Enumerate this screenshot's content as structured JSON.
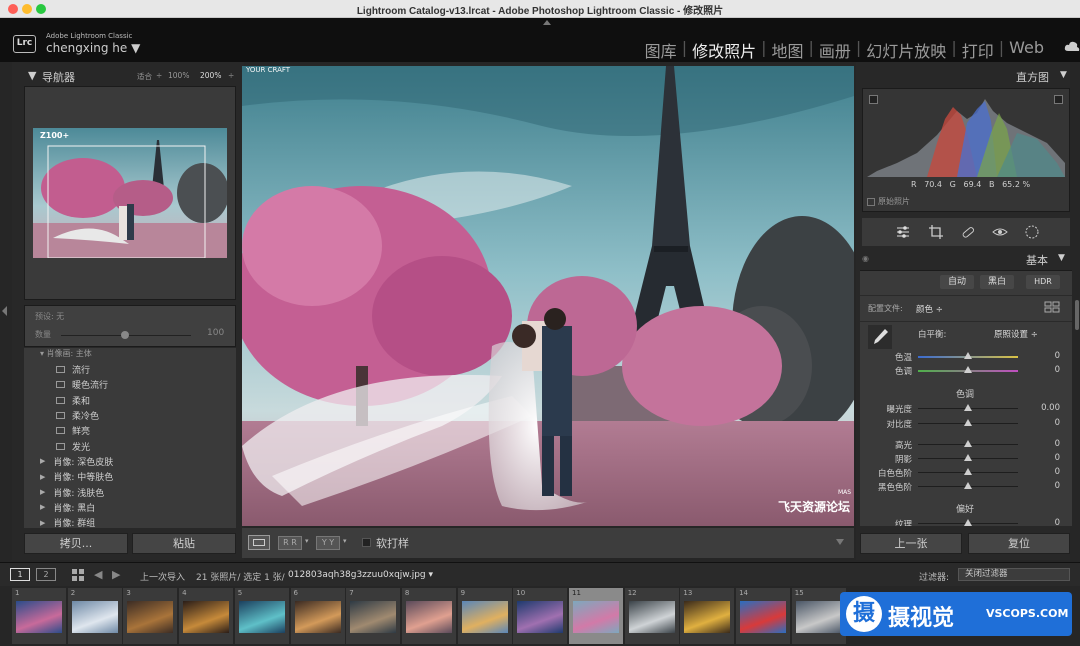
{
  "window": {
    "title": "Lightroom Catalog-v13.lrcat - Adobe Photoshop Lightroom Classic - 修改照片"
  },
  "identity": {
    "logo": "Lrc",
    "brand": "Adobe Lightroom Classic",
    "user": "chengxing he ▼"
  },
  "modules": [
    {
      "label": "图库",
      "active": false
    },
    {
      "label": "修改照片",
      "active": true
    },
    {
      "label": "地图",
      "active": false
    },
    {
      "label": "画册",
      "active": false
    },
    {
      "label": "幻灯片放映",
      "active": false
    },
    {
      "label": "打印",
      "active": false
    },
    {
      "label": "Web",
      "active": false
    }
  ],
  "navigator": {
    "title": "导航器",
    "fit": "适合",
    "zoom1": "100%",
    "zoom2": "200%",
    "overlay_text": "Z100+"
  },
  "presets": {
    "preset_label": "预设: 无",
    "amount_label": "数量",
    "amount_value": "100",
    "group_header": "▾ 肖像画: 主体",
    "items": [
      "流行",
      "暖色流行",
      "柔和",
      "柔冷色",
      "鲜亮",
      "发光"
    ],
    "groups": [
      "肖像: 深色皮肤",
      "肖像: 中等肤色",
      "肖像: 浅肤色",
      "肖像: 黑白",
      "肖像: 群组"
    ]
  },
  "left_buttons": {
    "copy": "拷贝...",
    "paste": "粘贴"
  },
  "photo": {
    "watermark_top": "YOUR CRAFT",
    "watermark_bottom": "飞天资源论坛",
    "watermark_side": "MAS"
  },
  "toolbar": {
    "softproof_label": "软打样",
    "rr_label": "R R",
    "yy_label": "Y Y"
  },
  "histogram": {
    "title": "直方图",
    "r_label": "R",
    "r_value": "70.4",
    "g_label": "G",
    "g_value": "69.4",
    "b_label": "B",
    "b_value": "65.2 %",
    "original_label": "原始照片"
  },
  "basic": {
    "title": "基本",
    "auto": "自动",
    "bw": "黑白",
    "hdr": "HDR",
    "profile_label": "配置文件:",
    "profile_value": "颜色 ÷",
    "wb_label": "白平衡:",
    "wb_value": "原照设置 ÷",
    "tone_header": "色调",
    "presence_header": "偏好",
    "sliders": [
      {
        "label": "色温",
        "value": "0",
        "pos": 0.5,
        "group": "wb"
      },
      {
        "label": "色调",
        "value": "0",
        "pos": 0.5,
        "group": "wb"
      },
      {
        "label": "曝光度",
        "value": "0.00",
        "pos": 0.5,
        "group": "tone"
      },
      {
        "label": "对比度",
        "value": "0",
        "pos": 0.5,
        "group": "tone"
      },
      {
        "label": "高光",
        "value": "0",
        "pos": 0.5,
        "group": "tone2"
      },
      {
        "label": "阴影",
        "value": "0",
        "pos": 0.5,
        "group": "tone2"
      },
      {
        "label": "白色色阶",
        "value": "0",
        "pos": 0.5,
        "group": "tone2"
      },
      {
        "label": "黑色色阶",
        "value": "0",
        "pos": 0.5,
        "group": "tone2"
      },
      {
        "label": "纹理",
        "value": "0",
        "pos": 0.5,
        "group": "presence"
      }
    ]
  },
  "right_buttons": {
    "prev": "上一张",
    "reset": "复位"
  },
  "filmstrip": {
    "page1": "1",
    "page2": "2",
    "source": "上一次导入",
    "count": "21 张照片/ 选定 1 张/",
    "filename": "012803aqh38g3zzuu0xqjw.jpg ▾",
    "filter_label": "过滤器:",
    "filter_value": "关闭过滤器",
    "selected_index": 11,
    "thumbs": [
      "1",
      "2",
      "3",
      "4",
      "5",
      "6",
      "7",
      "8",
      "9",
      "10",
      "11",
      "12",
      "13",
      "14",
      "15"
    ]
  },
  "brand_watermark": {
    "name": "摄视觉",
    "site": "VSCOPS.COM"
  },
  "colors": {
    "accent": "#1f6fd8",
    "panel": "#3a3a3a"
  }
}
